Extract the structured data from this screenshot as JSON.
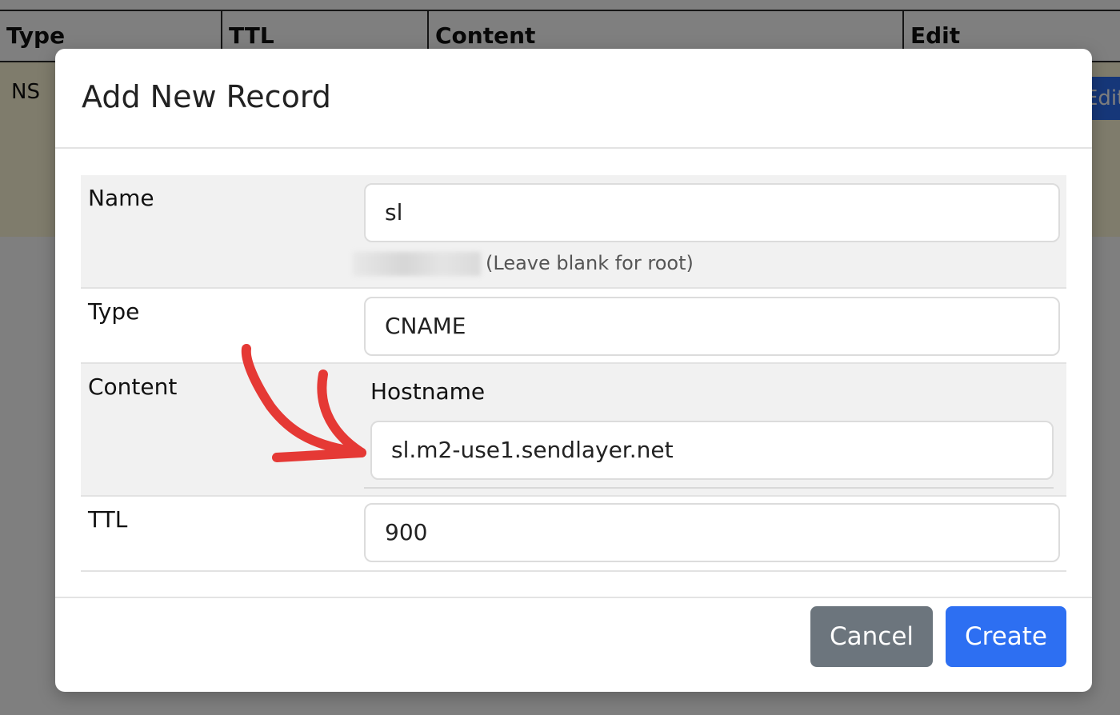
{
  "background_table": {
    "columns": [
      "Type",
      "TTL",
      "Content",
      "Edit"
    ],
    "row_type": "NS",
    "edit_button_label": "Edit"
  },
  "modal": {
    "title": "Add New Record",
    "fields": {
      "name": {
        "label": "Name",
        "value": "sl",
        "hint": "(Leave blank for root)"
      },
      "type": {
        "label": "Type",
        "value": "CNAME"
      },
      "content": {
        "label": "Content",
        "sublabel": "Hostname",
        "value": "sl.m2-use1.sendlayer.net"
      },
      "ttl": {
        "label": "TTL",
        "value": "900"
      }
    },
    "footer": {
      "cancel_label": "Cancel",
      "create_label": "Create"
    }
  },
  "colors": {
    "primary": "#2d6ff2",
    "secondary": "#6c757d",
    "annotation": "#e53935",
    "row_highlight": "#fff8d8"
  },
  "annotation": {
    "icon": "red-arrow-icon"
  }
}
